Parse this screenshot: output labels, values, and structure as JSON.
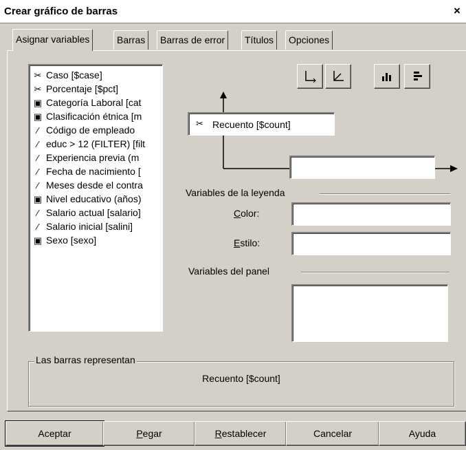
{
  "window": {
    "title": "Crear gráfico de barras",
    "close_glyph": "×"
  },
  "tabs": [
    {
      "label": "Asignar variables",
      "active": true
    },
    {
      "label": "Barras",
      "active": false
    },
    {
      "label": "Barras de error",
      "active": false
    },
    {
      "label": "Títulos",
      "active": false
    },
    {
      "label": "Opciones",
      "active": false
    }
  ],
  "variables": [
    {
      "label": "Caso [$case]",
      "icon": "scale-ruler-icon"
    },
    {
      "label": "Porcentaje [$pct]",
      "icon": "scale-ruler-icon"
    },
    {
      "label": "Categoría Laboral [cat",
      "icon": "nominal-bars-icon"
    },
    {
      "label": "Clasificación étnica [m",
      "icon": "nominal-bars-icon"
    },
    {
      "label": "Código de empleado",
      "icon": "ruler-icon"
    },
    {
      "label": "educ > 12 (FILTER) [filt",
      "icon": "ruler-icon"
    },
    {
      "label": "Experiencia previa (m",
      "icon": "ruler-icon"
    },
    {
      "label": "Fecha de nacimiento [",
      "icon": "ruler-icon"
    },
    {
      "label": "Meses desde el contra",
      "icon": "ruler-icon"
    },
    {
      "label": "Nivel educativo (años)",
      "icon": "nominal-bars-icon"
    },
    {
      "label": "Salario actual [salario]",
      "icon": "ruler-icon"
    },
    {
      "label": "Salario inicial [salini]",
      "icon": "ruler-icon"
    },
    {
      "label": "Sexo [sexo]",
      "icon": "nominal-bars-icon"
    }
  ],
  "chart_controls": {
    "orientation_buttons": [
      "axis-vertical-icon",
      "axis-diagonal-icon"
    ],
    "chart_type_buttons": [
      "vertical-bars-icon",
      "horizontal-bars-icon"
    ]
  },
  "y_axis": {
    "value": "Recuento [$count]"
  },
  "x_axis": {
    "value": ""
  },
  "legend": {
    "heading": "Variables de la leyenda",
    "color_label": "Color:",
    "color_mnemonic": "C",
    "color_rest": "olor:",
    "color_value": "",
    "style_label": "Estilo:",
    "style_mnemonic": "E",
    "style_rest": "stilo:",
    "style_value": ""
  },
  "panel": {
    "heading": "Variables del panel",
    "value": ""
  },
  "bars_represent": {
    "heading": "Las barras representan",
    "value": "Recuento [$count]"
  },
  "buttons": {
    "accept": "Aceptar",
    "paste_mnemonic": "P",
    "paste_rest": "egar",
    "reset_mnemonic": "R",
    "reset_rest": "establecer",
    "cancel": "Cancelar",
    "help": "Ayuda"
  },
  "colors": {
    "window_bg": "#d4d0c8",
    "field_bg": "#ffffff",
    "title_bg": "#ffffff"
  }
}
